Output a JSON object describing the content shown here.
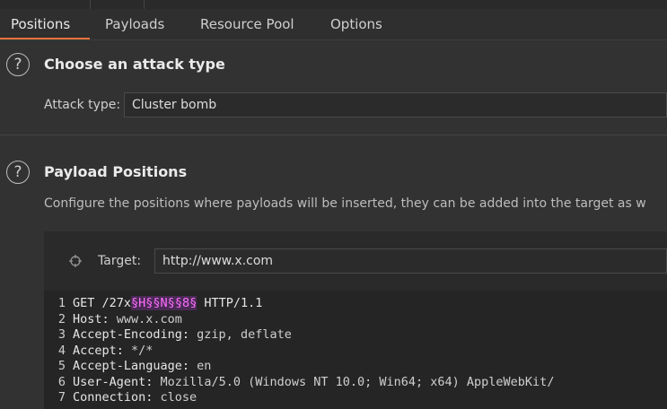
{
  "tabs": [
    {
      "label": "Positions",
      "active": true
    },
    {
      "label": "Payloads",
      "active": false
    },
    {
      "label": "Resource Pool",
      "active": false
    },
    {
      "label": "Options",
      "active": false
    }
  ],
  "attack_type": {
    "title": "Choose an attack type",
    "label": "Attack type:",
    "value": "Cluster bomb"
  },
  "payload_positions": {
    "title": "Payload Positions",
    "description": "Configure the positions where payloads will be inserted, they can be added into the target as w",
    "target_label": "Target:",
    "target_value": "http://www.x.com"
  },
  "request_lines": [
    {
      "num": "1",
      "parts": [
        {
          "t": "GET /27x",
          "c": ""
        },
        {
          "t": "§H§",
          "c": "pay"
        },
        {
          "t": "§N§",
          "c": "pay"
        },
        {
          "t": "§8§",
          "c": "pay"
        },
        {
          "t": " HTTP/1.1",
          "c": ""
        }
      ]
    },
    {
      "num": "2",
      "parts": [
        {
          "t": "Host: ",
          "c": "key"
        },
        {
          "t": "www.x.com",
          "c": "val"
        }
      ]
    },
    {
      "num": "3",
      "parts": [
        {
          "t": "Accept-Encoding: ",
          "c": "key"
        },
        {
          "t": "gzip, deflate",
          "c": "val"
        }
      ]
    },
    {
      "num": "4",
      "parts": [
        {
          "t": "Accept: ",
          "c": "key"
        },
        {
          "t": "*/*",
          "c": "val"
        }
      ]
    },
    {
      "num": "5",
      "parts": [
        {
          "t": "Accept-Language: ",
          "c": "key"
        },
        {
          "t": "en",
          "c": "val"
        }
      ]
    },
    {
      "num": "6",
      "parts": [
        {
          "t": "User-Agent: ",
          "c": "key"
        },
        {
          "t": "Mozilla/5.0 (Windows NT 10.0; Win64; x64) AppleWebKit/",
          "c": "val"
        }
      ]
    },
    {
      "num": "7",
      "parts": [
        {
          "t": "Connection: ",
          "c": "key"
        },
        {
          "t": "close",
          "c": "val"
        }
      ]
    }
  ],
  "colors": {
    "accent": "#e8733a",
    "payload_marker": "#ff6fff"
  }
}
